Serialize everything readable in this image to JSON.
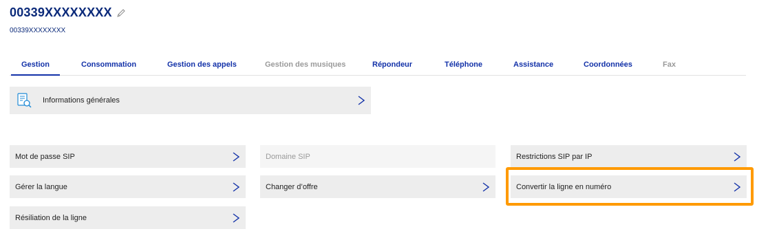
{
  "header": {
    "title": "00339XXXXXXXX",
    "subtitle": "00339XXXXXXXX"
  },
  "tabs": [
    {
      "label": "Gestion",
      "active": true
    },
    {
      "label": "Consommation"
    },
    {
      "label": "Gestion des appels"
    },
    {
      "label": "Gestion des musiques",
      "disabled": true
    },
    {
      "label": "Répondeur"
    },
    {
      "label": "Téléphone"
    },
    {
      "label": "Assistance"
    },
    {
      "label": "Coordonnées"
    },
    {
      "label": "Fax",
      "disabled": true
    }
  ],
  "info_card": {
    "label": "Informations générales",
    "icon": "document-search-icon"
  },
  "cards": {
    "sip_password": "Mot de passe SIP",
    "sip_domain": "Domaine SIP",
    "sip_restrictions": "Restrictions SIP par IP",
    "language": "Gérer la langue",
    "change_offer": "Changer d’offre",
    "convert_line": "Convertir la ligne en numéro",
    "terminate_line": "Résiliation de la ligne"
  },
  "colors": {
    "accent": "#1231a8",
    "title": "#0b2a7a",
    "highlight": "#ff9a00",
    "card_bg": "#ededed"
  }
}
